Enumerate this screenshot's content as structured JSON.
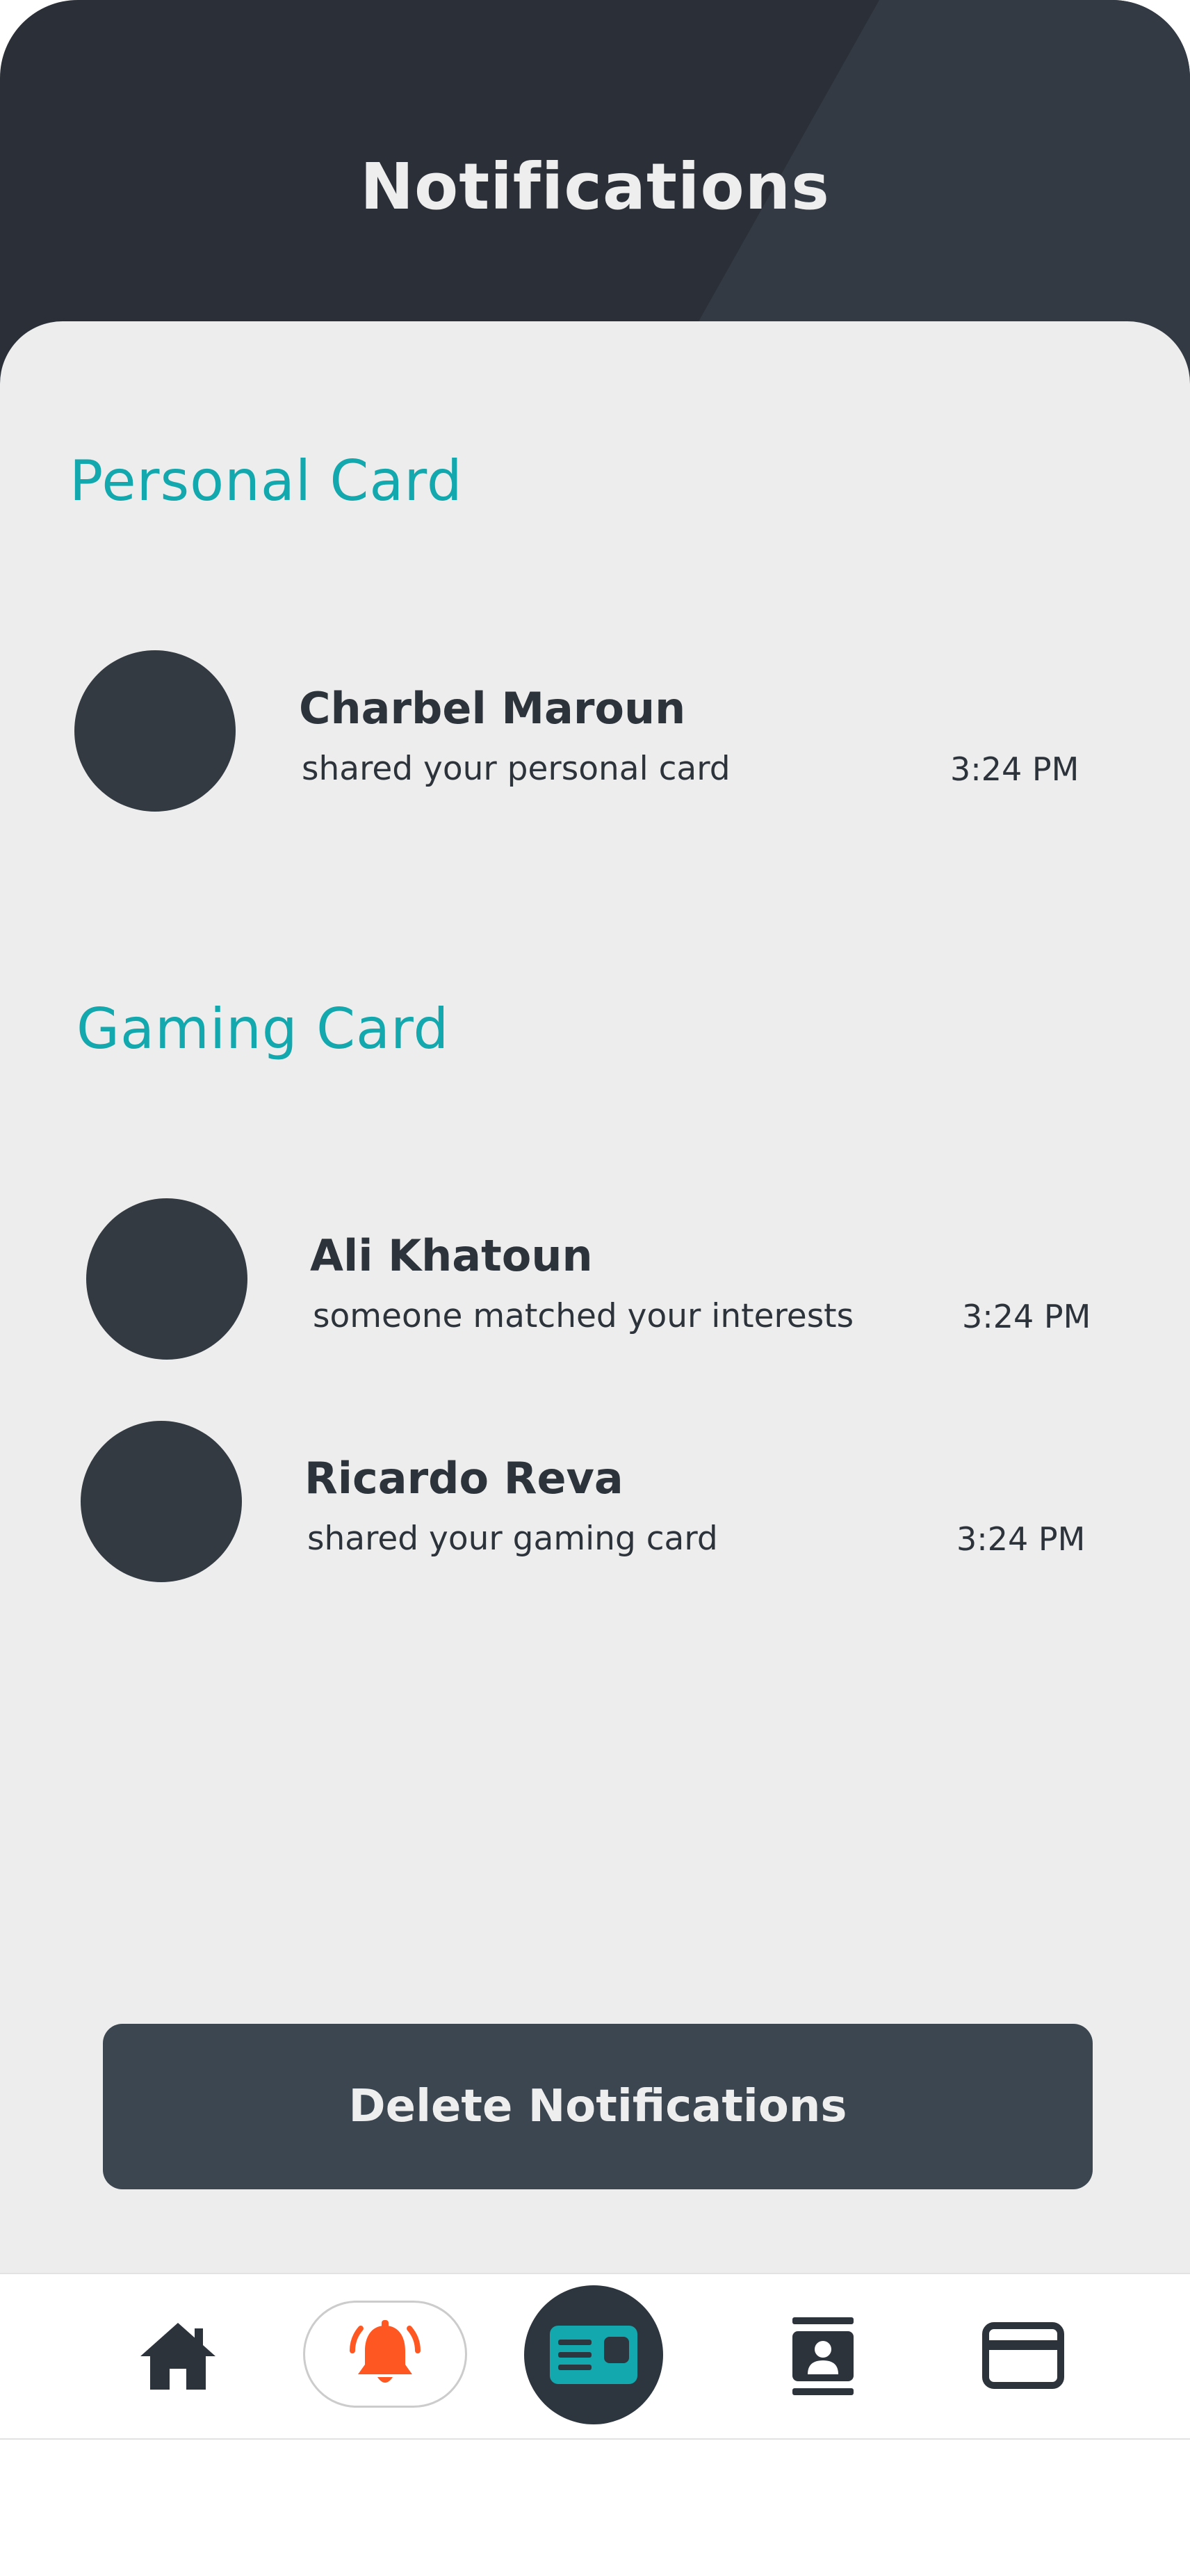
{
  "header": {
    "title": "Notifications"
  },
  "sections": [
    {
      "title": "Personal Card",
      "items": [
        {
          "name": "Charbel Maroun",
          "message": "shared your personal card",
          "time": "3:24 PM"
        }
      ]
    },
    {
      "title": "Gaming Card",
      "items": [
        {
          "name": "Ali Khatoun",
          "message": "someone matched your interests",
          "time": "3:24 PM"
        },
        {
          "name": "Ricardo Reva",
          "message": "shared your gaming card",
          "time": "3:24 PM"
        }
      ]
    }
  ],
  "actions": {
    "delete_label": "Delete Notifications"
  },
  "nav": {
    "items": [
      {
        "icon": "home-icon",
        "active": false
      },
      {
        "icon": "bell-icon",
        "active": true
      },
      {
        "icon": "id-card-icon",
        "active": false
      },
      {
        "icon": "contact-book-icon",
        "active": false
      },
      {
        "icon": "credit-card-icon",
        "active": false
      }
    ]
  },
  "colors": {
    "header_bg": "#2b3038",
    "content_bg": "#ededed",
    "accent_teal": "#12a8ad",
    "accent_orange": "#ff5722",
    "dark": "#2d333b",
    "button_bg": "#3c4650"
  }
}
